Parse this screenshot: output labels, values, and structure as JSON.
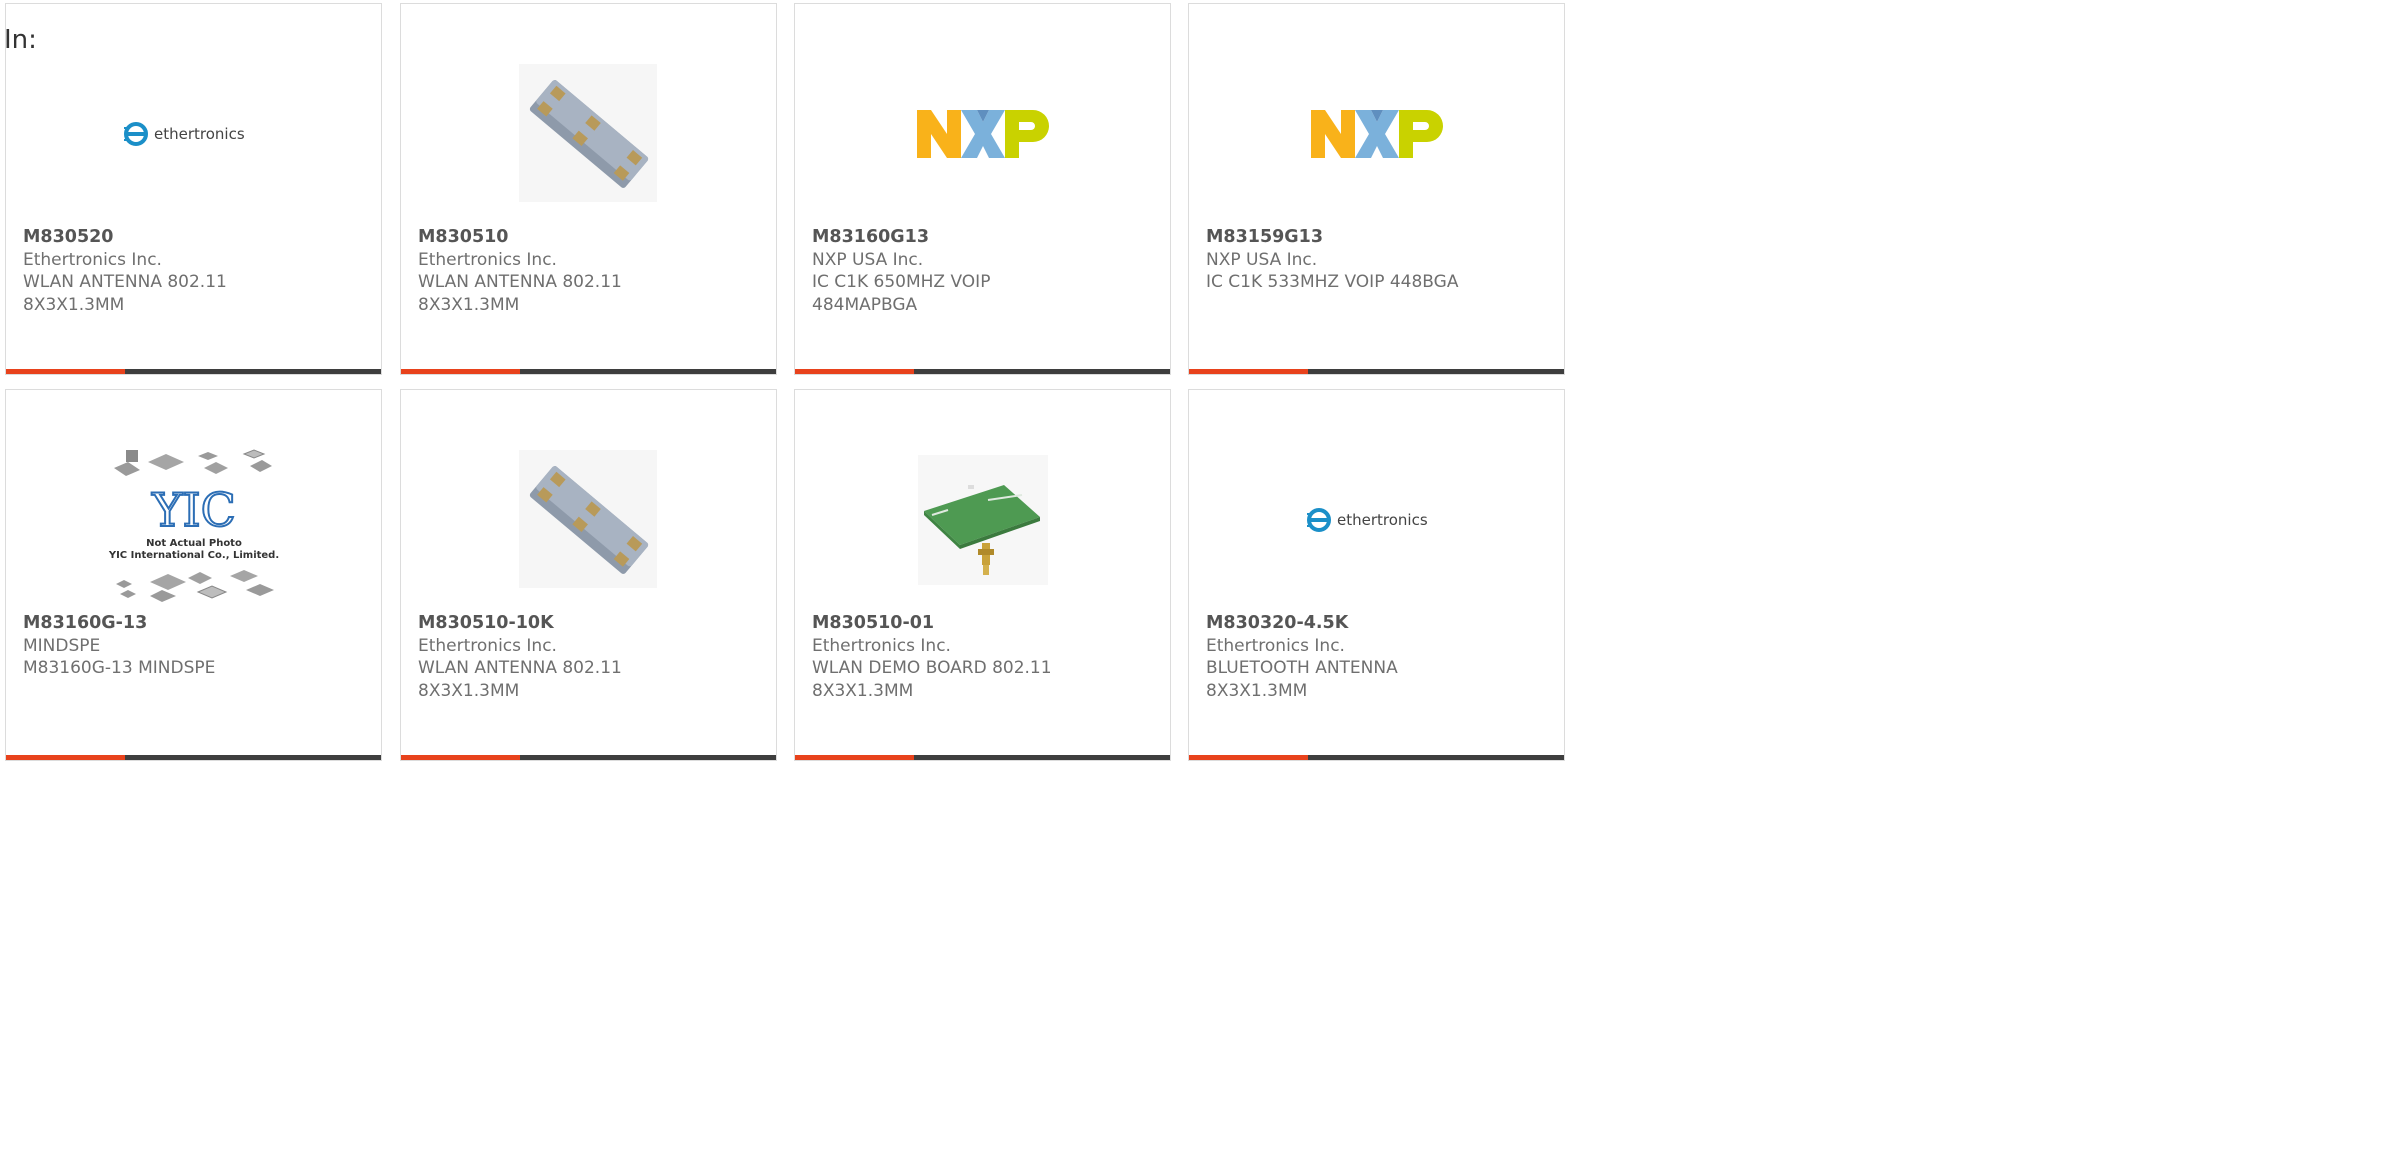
{
  "header": {
    "in_label": "In:"
  },
  "products": [
    {
      "part_number": "M830520",
      "manufacturer": "Ethertronics Inc.",
      "description": "WLAN ANTENNA 802.11\n8X3X1.3MM",
      "image": "ethertronics-logo"
    },
    {
      "part_number": "M830510",
      "manufacturer": "Ethertronics Inc.",
      "description": "WLAN ANTENNA 802.11\n8X3X1.3MM",
      "image": "chip-antenna-photo"
    },
    {
      "part_number": "M83160G13",
      "manufacturer": "NXP USA Inc.",
      "description": "IC C1K 650MHZ VOIP\n484MAPBGA",
      "image": "nxp-logo"
    },
    {
      "part_number": "M83159G13",
      "manufacturer": "NXP USA Inc.",
      "description": "IC C1K 533MHZ VOIP 448BGA",
      "image": "nxp-logo"
    },
    {
      "part_number": "M83160G-13",
      "manufacturer": "MINDSPE",
      "description": "M83160G-13 MINDSPE",
      "image": "yic-placeholder",
      "image_text": {
        "line1": "Not Actual Photo",
        "line2": "YIC International Co., Limited."
      }
    },
    {
      "part_number": "M830510-10K",
      "manufacturer": "Ethertronics Inc.",
      "description": "WLAN ANTENNA 802.11\n8X3X1.3MM",
      "image": "chip-antenna-photo"
    },
    {
      "part_number": "M830510-01",
      "manufacturer": "Ethertronics Inc.",
      "description": "WLAN DEMO BOARD 802.11\n8X3X1.3MM",
      "image": "demo-board-photo"
    },
    {
      "part_number": "M830320-4.5K",
      "manufacturer": "Ethertronics Inc.",
      "description": "BLUETOOTH ANTENNA\n8X3X1.3MM",
      "image": "ethertronics-logo"
    }
  ],
  "logo_text": {
    "ethertronics": "ethertronics",
    "yic": "YIC"
  },
  "colors": {
    "accent": "#e8421c",
    "bar": "#3e3e3e",
    "nxp_orange": "#f9b21a",
    "nxp_blue": "#7bb1db",
    "nxp_green": "#c9d200",
    "ethertronics_blue": "#1b8fc8"
  }
}
